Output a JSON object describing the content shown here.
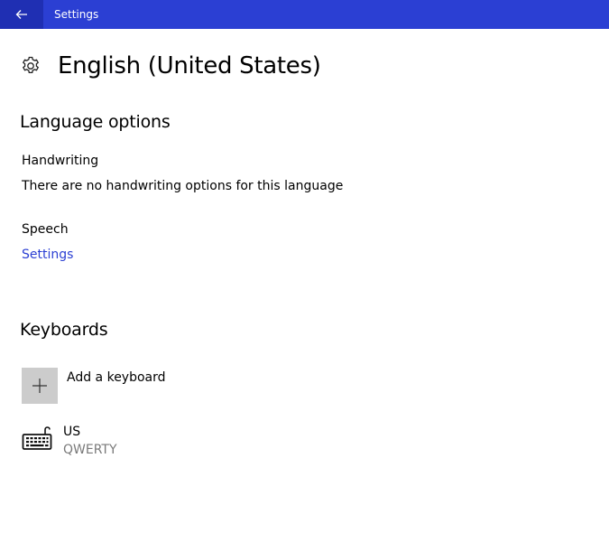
{
  "window": {
    "title": "Settings",
    "accent_color": "#2b3fd3",
    "back_icon": "arrow-left-icon"
  },
  "header": {
    "icon": "gear-icon",
    "title": "English (United States)"
  },
  "language_options": {
    "heading": "Language options",
    "handwriting": {
      "label": "Handwriting",
      "text": "There are no handwriting options for this language"
    },
    "speech": {
      "label": "Speech",
      "link": "Settings"
    }
  },
  "keyboards": {
    "heading": "Keyboards",
    "add_label": "Add a keyboard",
    "add_icon": "plus-icon",
    "items": [
      {
        "name": "US",
        "layout": "QWERTY",
        "icon": "keyboard-icon"
      }
    ]
  }
}
